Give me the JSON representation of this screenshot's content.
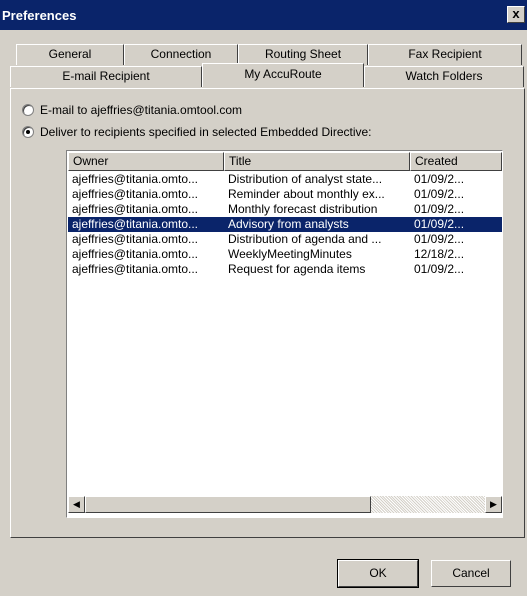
{
  "window": {
    "title": "Preferences",
    "close_glyph": "x"
  },
  "tabs_row1": [
    {
      "label": "General"
    },
    {
      "label": "Connection"
    },
    {
      "label": "Routing Sheet"
    },
    {
      "label": "Fax Recipient"
    }
  ],
  "tabs_row2": [
    {
      "label": "E-mail Recipient"
    },
    {
      "label": "My AccuRoute",
      "active": true
    },
    {
      "label": "Watch Folders"
    }
  ],
  "options": {
    "email_self": {
      "label": "E-mail to ajeffries@titania.omtool.com",
      "checked": false
    },
    "deliver_embedded": {
      "label": "Deliver to recipients specified in selected Embedded Directive:",
      "checked": true
    }
  },
  "list": {
    "columns": [
      "Owner",
      "Title",
      "Created"
    ],
    "rows": [
      {
        "owner": "ajeffries@titania.omto...",
        "title": "Distribution of analyst state...",
        "created": "01/09/2...",
        "selected": false
      },
      {
        "owner": "ajeffries@titania.omto...",
        "title": "Reminder about monthly ex...",
        "created": "01/09/2...",
        "selected": false
      },
      {
        "owner": "ajeffries@titania.omto...",
        "title": "Monthly forecast distribution",
        "created": "01/09/2...",
        "selected": false
      },
      {
        "owner": "ajeffries@titania.omto...",
        "title": "Advisory from analysts",
        "created": "01/09/2...",
        "selected": true
      },
      {
        "owner": "ajeffries@titania.omto...",
        "title": "Distribution of agenda and ...",
        "created": "01/09/2...",
        "selected": false
      },
      {
        "owner": "ajeffries@titania.omto...",
        "title": "WeeklyMeetingMinutes",
        "created": "12/18/2...",
        "selected": false
      },
      {
        "owner": "ajeffries@titania.omto...",
        "title": "Request for agenda items",
        "created": "01/09/2...",
        "selected": false
      }
    ]
  },
  "scrollbar": {
    "left_glyph": "◀",
    "right_glyph": "▶"
  },
  "buttons": {
    "ok": "OK",
    "cancel": "Cancel"
  },
  "colors": {
    "face": "#d4d0c8",
    "title_bar": "#0a246a",
    "selection": "#0a246a"
  }
}
